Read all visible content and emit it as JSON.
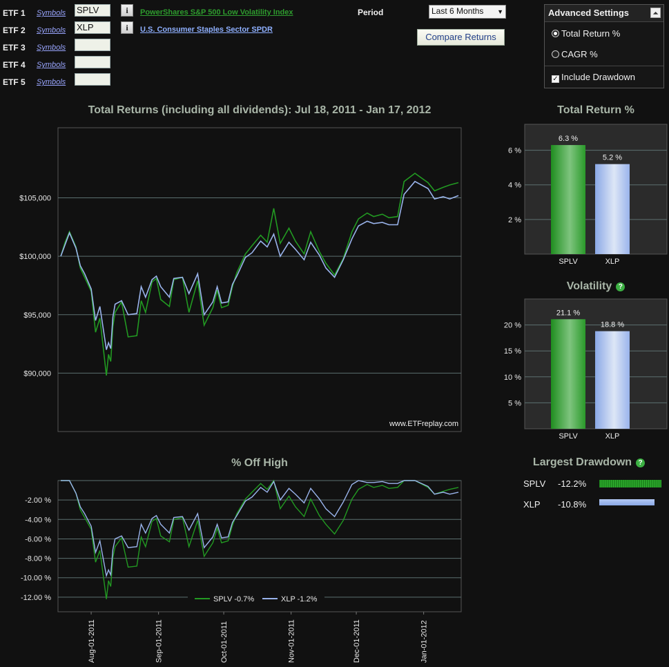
{
  "etf_form": {
    "rows": [
      {
        "label": "ETF 1",
        "link": "Symbols",
        "value": "SPLV",
        "name": "PowerShares S&P 500 Low Volatility Index",
        "color": "#2e9c2e"
      },
      {
        "label": "ETF 2",
        "link": "Symbols",
        "value": "XLP",
        "name": "U.S. Consumer Staples Sector SPDR",
        "color": "#8fb0ff"
      },
      {
        "label": "ETF 3",
        "link": "Symbols",
        "value": ""
      },
      {
        "label": "ETF 4",
        "link": "Symbols",
        "value": ""
      },
      {
        "label": "ETF 5",
        "link": "Symbols",
        "value": ""
      }
    ],
    "info_icon": "info-icon"
  },
  "period": {
    "label": "Period",
    "selected": "Last 6 Months"
  },
  "compare_button": "Compare Returns",
  "advanced": {
    "title": "Advanced Settings",
    "options": [
      {
        "label": "Total Return %",
        "type": "radio",
        "checked": true
      },
      {
        "label": "CAGR %",
        "type": "radio",
        "checked": false
      },
      {
        "label": "Include Drawdown",
        "type": "checkbox",
        "checked": true
      }
    ]
  },
  "main_chart": {
    "title": "Total Returns (including all dividends): Jul 18, 2011 - Jan 17, 2012",
    "watermark": "www.ETFreplay.com"
  },
  "offhigh_chart": {
    "title": "% Off High"
  },
  "total_return": {
    "title": "Total Return %"
  },
  "volatility": {
    "title": "Volatility"
  },
  "drawdown": {
    "title": "Largest Drawdown",
    "rows": [
      {
        "symbol": "SPLV",
        "value": "-12.2%"
      },
      {
        "symbol": "XLP",
        "value": "-10.8%"
      }
    ]
  },
  "colors": {
    "splv": "#229a22",
    "xlp": "#9ab4ec",
    "accent_green": "#3cb043"
  },
  "chart_data": [
    {
      "type": "line",
      "title": "Total Returns (including all dividends): Jul 18, 2011 - Jan 17, 2012",
      "ylim": [
        85000,
        111000
      ],
      "yticks": [
        90000,
        95000,
        100000,
        105000
      ],
      "ytick_labels": [
        "$90,000",
        "$95,000",
        "$100,000",
        "$105,000"
      ],
      "x": [
        "2011-07-18",
        "2011-07-20",
        "2011-07-22",
        "2011-07-25",
        "2011-07-27",
        "2011-07-29",
        "2011-08-01",
        "2011-08-03",
        "2011-08-05",
        "2011-08-08",
        "2011-08-09",
        "2011-08-10",
        "2011-08-11",
        "2011-08-12",
        "2011-08-15",
        "2011-08-18",
        "2011-08-22",
        "2011-08-24",
        "2011-08-26",
        "2011-08-29",
        "2011-08-31",
        "2011-09-02",
        "2011-09-06",
        "2011-09-08",
        "2011-09-12",
        "2011-09-15",
        "2011-09-19",
        "2011-09-22",
        "2011-09-26",
        "2011-09-28",
        "2011-09-30",
        "2011-10-03",
        "2011-10-05",
        "2011-10-07",
        "2011-10-11",
        "2011-10-14",
        "2011-10-18",
        "2011-10-21",
        "2011-10-24",
        "2011-10-27",
        "2011-10-31",
        "2011-11-03",
        "2011-11-07",
        "2011-11-10",
        "2011-11-14",
        "2011-11-17",
        "2011-11-21",
        "2011-11-25",
        "2011-11-29",
        "2011-12-02",
        "2011-12-06",
        "2011-12-09",
        "2011-12-13",
        "2011-12-16",
        "2011-12-20",
        "2011-12-23",
        "2011-12-28",
        "2012-01-03",
        "2012-01-06",
        "2012-01-10",
        "2012-01-13",
        "2012-01-17"
      ],
      "series": [
        {
          "name": "SPLV",
          "values": [
            100000,
            101200,
            102100,
            100800,
            99000,
            98200,
            97000,
            93500,
            94700,
            89800,
            91600,
            91000,
            94000,
            95200,
            96100,
            93100,
            93200,
            96200,
            95200,
            97800,
            98100,
            96300,
            95700,
            98000,
            98200,
            95200,
            97900,
            94100,
            95600,
            97100,
            95600,
            95800,
            97400,
            98600,
            100200,
            100900,
            101800,
            101200,
            104100,
            101100,
            102400,
            101300,
            100200,
            102100,
            100400,
            99400,
            98400,
            99800,
            102100,
            103200,
            103700,
            103400,
            103600,
            103300,
            103400,
            106400,
            107100,
            106300,
            105600,
            105900,
            106100,
            106300
          ]
        },
        {
          "name": "XLP",
          "values": [
            100000,
            101000,
            102000,
            100700,
            99200,
            98500,
            97200,
            94500,
            95700,
            92000,
            92600,
            92100,
            94800,
            95900,
            96200,
            95000,
            95100,
            97400,
            96500,
            98000,
            98300,
            97400,
            96500,
            98100,
            98200,
            96800,
            98500,
            95000,
            96100,
            97400,
            96000,
            96100,
            97600,
            98300,
            99900,
            100300,
            101300,
            100800,
            101900,
            100000,
            101200,
            100600,
            99700,
            101200,
            100100,
            99000,
            98200,
            99700,
            101500,
            102600,
            103000,
            102800,
            102900,
            102700,
            102700,
            105300,
            106400,
            105800,
            104900,
            105100,
            104900,
            105200
          ]
        }
      ]
    },
    {
      "type": "line",
      "title": "% Off High",
      "ylim": [
        -13.5,
        0
      ],
      "yticks": [
        -2,
        -4,
        -6,
        -8,
        -10,
        -12
      ],
      "ytick_labels": [
        "-2.00 %",
        "-4.00 %",
        "-6.00 %",
        "-8.00 %",
        "-10.00 %",
        "-12.00 %"
      ],
      "xtick_labels": [
        "Aug-01-2011",
        "Sep-01-2011",
        "Oct-01-2011",
        "Nov-01-2011",
        "Dec-01-2011",
        "Jan-01-2012"
      ],
      "xtick_dates": [
        "2011-08-01",
        "2011-09-01",
        "2011-10-01",
        "2011-11-01",
        "2011-12-01",
        "2012-01-01"
      ],
      "series": [
        {
          "name": "SPLV",
          "legend": "SPLV -0.7%",
          "values": [
            0,
            0,
            0,
            -1.3,
            -3.0,
            -3.8,
            -5.0,
            -8.4,
            -7.2,
            -12.2,
            -10.3,
            -10.9,
            -7.9,
            -6.8,
            -5.9,
            -8.9,
            -8.8,
            -5.8,
            -6.8,
            -4.2,
            -3.9,
            -5.7,
            -6.3,
            -4.0,
            -3.8,
            -6.8,
            -4.1,
            -7.8,
            -6.4,
            -4.9,
            -6.4,
            -6.2,
            -4.6,
            -3.4,
            -1.9,
            -1.2,
            -0.3,
            -0.9,
            0,
            -2.9,
            -1.6,
            -2.7,
            -3.7,
            -1.9,
            -3.6,
            -4.5,
            -5.5,
            -4.1,
            -1.9,
            -0.9,
            -0.4,
            -0.7,
            -0.5,
            -0.8,
            -0.7,
            0,
            0,
            -0.7,
            -1.4,
            -1.1,
            -0.9,
            -0.7
          ]
        },
        {
          "name": "XLP",
          "legend": "XLP -1.2%",
          "values": [
            0,
            0,
            0,
            -1.3,
            -2.7,
            -3.4,
            -4.7,
            -7.4,
            -6.2,
            -9.8,
            -9.2,
            -9.7,
            -7.1,
            -6.0,
            -5.7,
            -6.9,
            -6.8,
            -4.5,
            -5.4,
            -3.9,
            -3.6,
            -4.5,
            -5.4,
            -3.8,
            -3.7,
            -5.1,
            -3.4,
            -6.9,
            -5.8,
            -4.5,
            -5.9,
            -5.8,
            -4.3,
            -3.6,
            -2.1,
            -1.7,
            -0.7,
            -1.2,
            -0.1,
            -2.0,
            -0.8,
            -1.4,
            -2.3,
            -0.8,
            -1.9,
            -2.9,
            -3.7,
            -2.2,
            -0.4,
            0,
            -0.2,
            -0.2,
            -0.1,
            -0.3,
            -0.3,
            0,
            0,
            -0.6,
            -1.4,
            -1.2,
            -1.4,
            -1.2
          ]
        }
      ]
    },
    {
      "type": "bar",
      "title": "Total Return %",
      "categories": [
        "SPLV",
        "XLP"
      ],
      "values": [
        6.3,
        5.2
      ],
      "value_labels": [
        "6.3 %",
        "5.2 %"
      ],
      "ylim": [
        0,
        7.5
      ],
      "yticks": [
        2,
        4,
        6
      ],
      "ytick_labels": [
        "2 %",
        "4 %",
        "6 %"
      ]
    },
    {
      "type": "bar",
      "title": "Volatility",
      "categories": [
        "SPLV",
        "XLP"
      ],
      "values": [
        21.1,
        18.8
      ],
      "value_labels": [
        "21.1 %",
        "18.8 %"
      ],
      "ylim": [
        0,
        25
      ],
      "yticks": [
        5,
        10,
        15,
        20
      ],
      "ytick_labels": [
        "5 %",
        "10 %",
        "15 %",
        "20 %"
      ]
    },
    {
      "type": "bar",
      "title": "Largest Drawdown",
      "categories": [
        "SPLV",
        "XLP"
      ],
      "values": [
        -12.2,
        -10.8
      ]
    }
  ]
}
